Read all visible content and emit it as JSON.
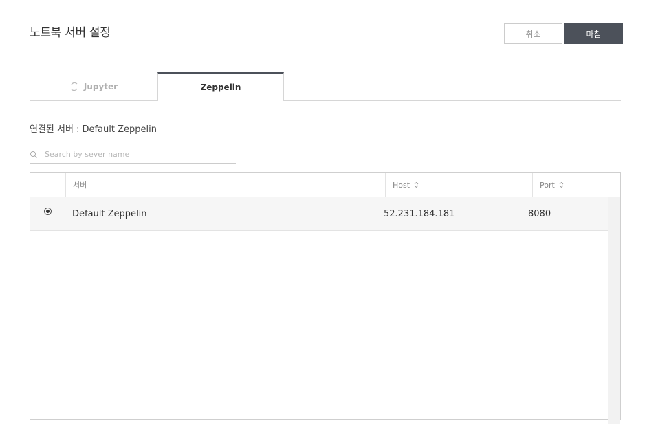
{
  "header": {
    "title": "노트북 서버 설정",
    "cancel_label": "취소",
    "done_label": "마침"
  },
  "tabs": [
    {
      "label": "Jupyter",
      "active": false,
      "icon": "spinner-icon"
    },
    {
      "label": "Zeppelin",
      "active": true
    }
  ],
  "connected": {
    "label": "연결된 서버 :",
    "value": "Default Zeppelin"
  },
  "search": {
    "placeholder": "Search by sever name",
    "value": ""
  },
  "table": {
    "columns": [
      "서버",
      "Host",
      "Port"
    ],
    "rows": [
      {
        "selected": true,
        "server": "Default Zeppelin",
        "host": "52.231.184.181",
        "port": "8080"
      }
    ]
  },
  "colors": {
    "primary_button": "#4c515a",
    "row_background": "#f6f6f6"
  }
}
